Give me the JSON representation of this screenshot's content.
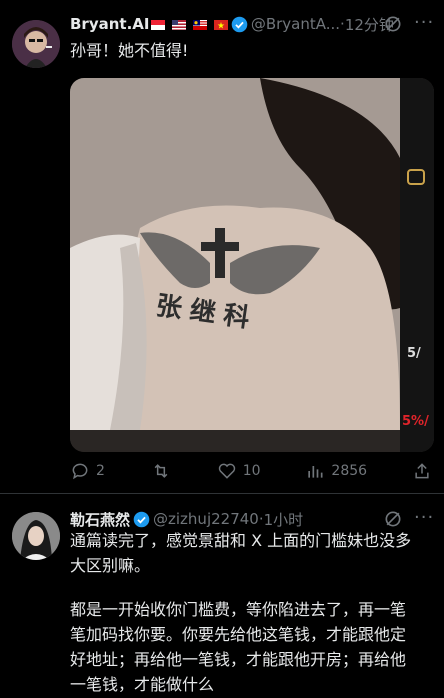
{
  "tweet1": {
    "display_name": "Bryant.AI",
    "handle": "@BryantA...",
    "time": "12分钟",
    "text": "孙哥！她不值得!",
    "image_caption": "张继科",
    "side_label_a": "5/",
    "side_label_b": "5%/",
    "replies": "2",
    "likes": "10",
    "views": "2856"
  },
  "tweet2": {
    "display_name": "勒石燕然",
    "handle": "@zizhuj22740",
    "time": "1小时",
    "line1": "通篇读完了，感觉景甜和 X 上面的门槛妹也没多",
    "line2": "大区别嘛。",
    "line3": "都是一开始收你门槛费，等你陷进去了，再一笔",
    "line4": "笔加码找你要。你要先给他这笔钱，才能跟他定",
    "line5": "好地址；再给他一笔钱，才能跟他开房；再给他",
    "line6": "一笔钱，才能做什么"
  },
  "colors": {
    "background": "#000000",
    "verified_blue": "#1d9bf0",
    "secondary": "#71767b"
  }
}
